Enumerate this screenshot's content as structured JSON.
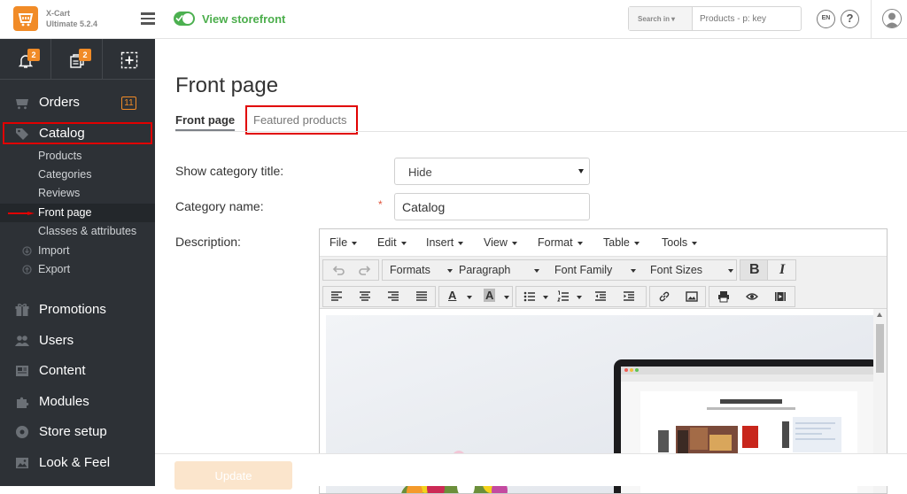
{
  "header": {
    "brand_name": "X-Cart",
    "brand_version": "Ultimate 5.2.4",
    "storefront_label": "View storefront",
    "search_scope": "Search in",
    "search_placeholder": "Products - p: key",
    "language_code": "EN",
    "help_label": "?"
  },
  "sidebar": {
    "quick_actions": [
      {
        "icon": "bell-icon",
        "badge": "2"
      },
      {
        "icon": "orders-copy-icon",
        "badge": "2"
      },
      {
        "icon": "add-square-icon",
        "badge": ""
      }
    ],
    "orders": {
      "label": "Orders",
      "count": "11",
      "icon": "cart-icon"
    },
    "catalog": {
      "label": "Catalog",
      "icon": "tag-icon",
      "highlighted": true
    },
    "catalog_items": [
      {
        "label": "Products"
      },
      {
        "label": "Categories"
      },
      {
        "label": "Reviews"
      },
      {
        "label": "Front page",
        "active": true
      },
      {
        "label": "Classes & attributes"
      },
      {
        "label": "Import"
      },
      {
        "label": "Export"
      }
    ],
    "main_items": [
      {
        "label": "Promotions",
        "icon": "gift-icon"
      },
      {
        "label": "Users",
        "icon": "users-icon"
      },
      {
        "label": "Content",
        "icon": "content-icon"
      },
      {
        "label": "Modules",
        "icon": "puzzle-icon"
      },
      {
        "label": "Store setup",
        "icon": "gear-icon"
      },
      {
        "label": "Look & Feel",
        "icon": "image-icon"
      }
    ]
  },
  "page": {
    "title": "Front page",
    "tabs": [
      {
        "label": "Front page",
        "active": true
      },
      {
        "label": "Featured products",
        "highlighted": true
      }
    ],
    "form": {
      "show_category_title_label": "Show category title:",
      "show_category_title_value": "Hide",
      "category_name_label": "Category name:",
      "category_name_value": "Catalog",
      "required_mark": "*",
      "description_label": "Description:"
    },
    "update_label": "Update"
  },
  "editor": {
    "menu": [
      "File",
      "Edit",
      "Insert",
      "View",
      "Format",
      "Table",
      "Tools"
    ],
    "formats_label": "Formats",
    "paragraph_label": "Paragraph",
    "font_family_label": "Font Family",
    "font_sizes_label": "Font Sizes",
    "bold_label": "B",
    "italic_label": "I",
    "text_color_label": "A",
    "bg_color_label": "A"
  },
  "colors": {
    "accent": "#f18b27",
    "sidebar_bg": "#2d3136",
    "highlight": "#e10000",
    "storefront_green": "#4cb050"
  }
}
